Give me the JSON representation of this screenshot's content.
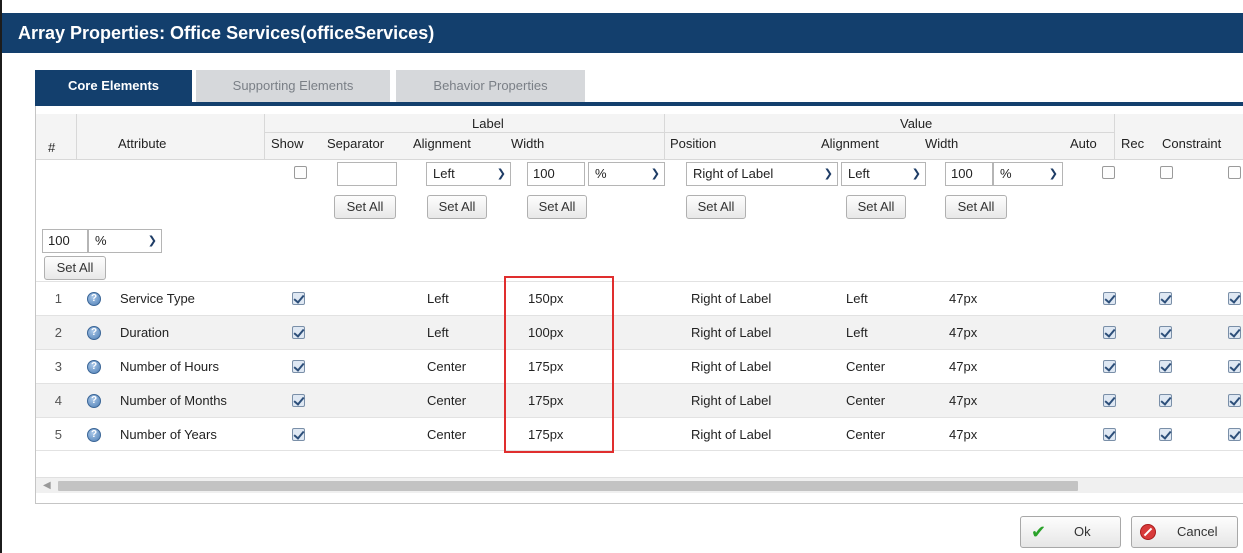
{
  "dialog": {
    "title": "Array Properties: Office Services(officeServices)"
  },
  "tabs": [
    {
      "label": "Core Elements",
      "active": true
    },
    {
      "label": "Supporting Elements",
      "active": false
    },
    {
      "label": "Behavior Properties",
      "active": false
    }
  ],
  "grid": {
    "group_headers": {
      "label": "Label",
      "value": "Value"
    },
    "columns": {
      "num": "#",
      "attribute": "Attribute",
      "show": "Show",
      "separator": "Separator",
      "label_alignment": "Alignment",
      "label_width": "Width",
      "position": "Position",
      "value_alignment": "Alignment",
      "value_width": "Width",
      "auto": "Auto",
      "rec": "Rec",
      "constraint": "Constraint"
    },
    "defaults": {
      "label_alignment": "Left",
      "label_width": "100",
      "label_width_unit": "%",
      "position": "Right of Label",
      "value_alignment": "Left",
      "value_width": "100",
      "value_width_unit": "%",
      "extra_width": "100",
      "extra_width_unit": "%",
      "set_all": "Set All"
    },
    "rows": [
      {
        "num": "1",
        "attribute": "Service Type",
        "show": true,
        "label_alignment": "Left",
        "label_width": "150px",
        "position": "Right of Label",
        "value_alignment": "Left",
        "value_width": "47px",
        "auto": true,
        "rec": true,
        "constraint": true
      },
      {
        "num": "2",
        "attribute": "Duration",
        "show": true,
        "label_alignment": "Left",
        "label_width": "100px",
        "position": "Right of Label",
        "value_alignment": "Left",
        "value_width": "47px",
        "auto": true,
        "rec": true,
        "constraint": true
      },
      {
        "num": "3",
        "attribute": "Number of Hours",
        "show": true,
        "label_alignment": "Center",
        "label_width": "175px",
        "position": "Right of Label",
        "value_alignment": "Center",
        "value_width": "47px",
        "auto": true,
        "rec": true,
        "constraint": true
      },
      {
        "num": "4",
        "attribute": "Number of Months",
        "show": true,
        "label_alignment": "Center",
        "label_width": "175px",
        "position": "Right of Label",
        "value_alignment": "Center",
        "value_width": "47px",
        "auto": true,
        "rec": true,
        "constraint": true
      },
      {
        "num": "5",
        "attribute": "Number of Years",
        "show": true,
        "label_alignment": "Center",
        "label_width": "175px",
        "position": "Right of Label",
        "value_alignment": "Center",
        "value_width": "47px",
        "auto": true,
        "rec": true,
        "constraint": true
      }
    ]
  },
  "buttons": {
    "ok": "Ok",
    "cancel": "Cancel"
  },
  "colors": {
    "titlebar": "#133f6d",
    "highlight": "#e02e2e"
  }
}
